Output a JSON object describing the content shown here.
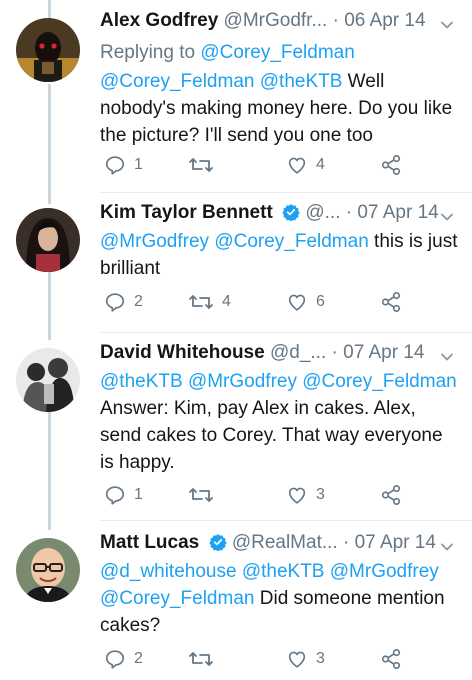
{
  "tweets": [
    {
      "name": "Alex Godfrey",
      "handle": "@MrGodfr...",
      "sep": "·",
      "date": "06 Apr 14",
      "verified": false,
      "replying_label": "Replying to",
      "replying_to": "@Corey_Feldman",
      "text_parts": [
        {
          "t": "@Corey_Feldman",
          "m": true
        },
        {
          "t": " ",
          "m": false
        },
        {
          "t": "@theKTB",
          "m": true
        },
        {
          "t": " Well nobody's making money here. Do you like the picture? I'll send you one too",
          "m": false
        }
      ],
      "replies": "1",
      "retweets": "",
      "likes": "4"
    },
    {
      "name": "Kim Taylor Bennett",
      "handle": "@...",
      "sep": "·",
      "date": "07 Apr 14",
      "verified": true,
      "text_parts": [
        {
          "t": "@MrGodfrey",
          "m": true
        },
        {
          "t": " ",
          "m": false
        },
        {
          "t": "@Corey_Feldman",
          "m": true
        },
        {
          "t": " this is just brilliant",
          "m": false
        }
      ],
      "replies": "2",
      "retweets": "4",
      "likes": "6"
    },
    {
      "name": "David Whitehouse",
      "handle": "@d_...",
      "sep": "·",
      "date": "07 Apr 14",
      "verified": false,
      "text_parts": [
        {
          "t": "@theKTB",
          "m": true
        },
        {
          "t": " ",
          "m": false
        },
        {
          "t": "@MrGodfrey",
          "m": true
        },
        {
          "t": " ",
          "m": false
        },
        {
          "t": "@Corey_Feldman",
          "m": true
        },
        {
          "t": " Answer: Kim, pay Alex in cakes. Alex, send cakes to Corey. That way everyone is happy.",
          "m": false
        }
      ],
      "replies": "1",
      "retweets": "",
      "likes": "3"
    },
    {
      "name": "Matt Lucas",
      "handle": "@RealMat...",
      "sep": "·",
      "date": "07 Apr 14",
      "verified": true,
      "text_parts": [
        {
          "t": "@d_whitehouse",
          "m": true
        },
        {
          "t": " ",
          "m": false
        },
        {
          "t": "@theKTB",
          "m": true
        },
        {
          "t": " ",
          "m": false
        },
        {
          "t": "@MrGodfrey",
          "m": true
        },
        {
          "t": " ",
          "m": false
        },
        {
          "t": "@Corey_Feldman",
          "m": true
        },
        {
          "t": " Did someone mention cakes?",
          "m": false
        }
      ],
      "replies": "2",
      "retweets": "",
      "likes": "3"
    }
  ],
  "colors": {
    "link": "#1da1f2",
    "muted": "#657786",
    "text": "#14171a",
    "thread_line": "#ccd6dd",
    "verified": "#1da1f2"
  },
  "icons": {
    "reply": "reply-icon",
    "retweet": "retweet-icon",
    "like": "heart-icon",
    "share": "share-icon",
    "verified": "verified-badge-icon",
    "caret": "chevron-down-icon"
  }
}
